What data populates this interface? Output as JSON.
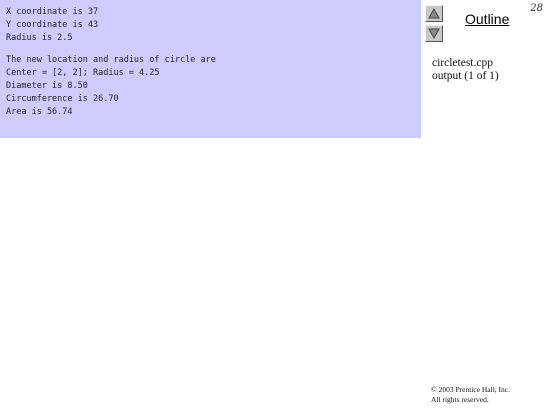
{
  "page_number": "28",
  "output": {
    "lines": [
      "X coordinate is 37",
      "Y coordinate is 43",
      "Radius is 2.5",
      "",
      "The new location and radius of circle are",
      "Center = [2, 2]; Radius = 4.25",
      "Diameter is 8.50",
      "Circumference is 26.70",
      "Area is 56.74"
    ],
    "background_color": "#ccccff"
  },
  "navigation": {
    "up_icon": "triangle-up-icon",
    "down_icon": "triangle-down-icon"
  },
  "outline": {
    "title": "Outline"
  },
  "file_caption": {
    "line1": "circletest.cpp",
    "line2": "output (1 of 1)"
  },
  "copyright": {
    "line1": "© 2003 Prentice Hall, Inc.",
    "line2": "All rights reserved."
  }
}
